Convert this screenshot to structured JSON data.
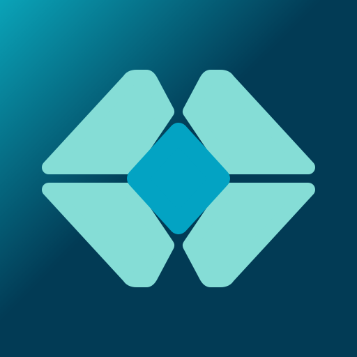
{
  "icon": {
    "name": "diamond-mosaic-logo",
    "colors": {
      "background": "#023b55",
      "background_glow": "#0aa3b8",
      "tile": "#85ddd6",
      "center": "#03a3c3"
    }
  }
}
